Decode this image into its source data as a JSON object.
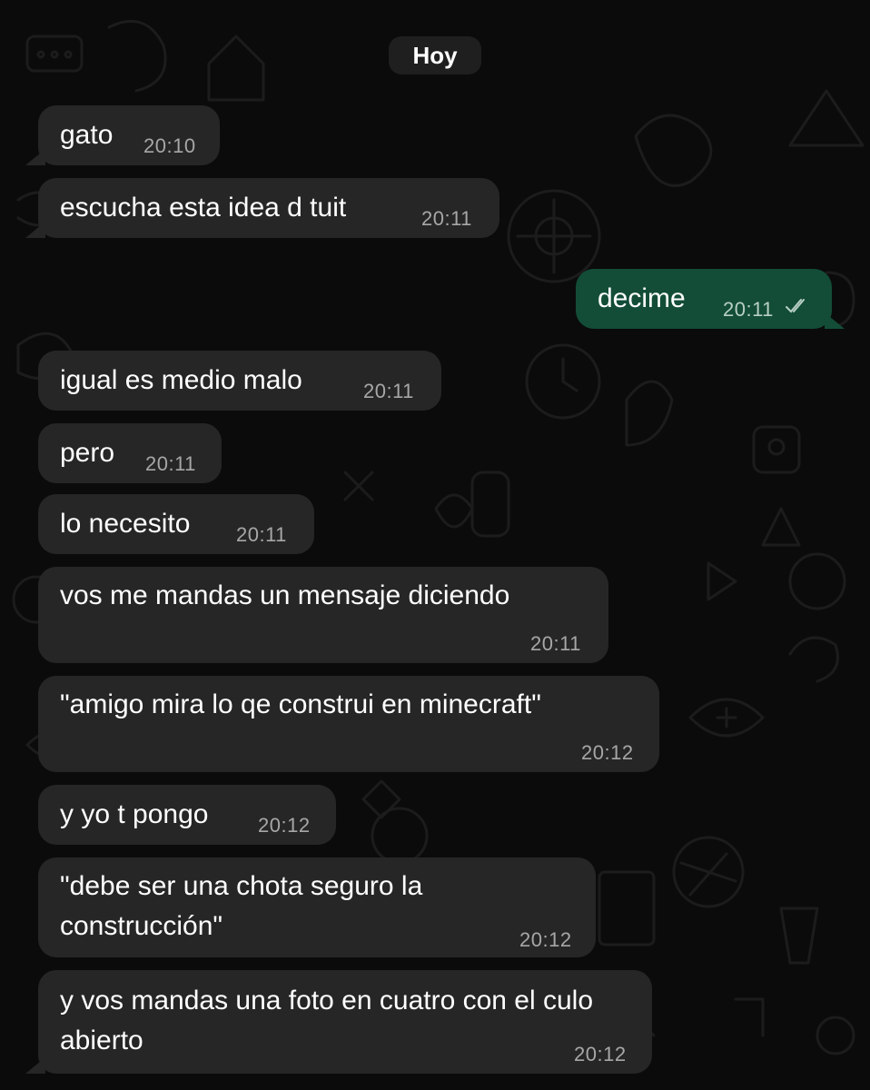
{
  "date_separator": "Hoy",
  "messages": [
    {
      "dir": "in",
      "text": "gato",
      "time": "20:10"
    },
    {
      "dir": "in",
      "text": "escucha esta idea d tuit",
      "time": "20:11"
    },
    {
      "dir": "out",
      "text": "decime",
      "time": "20:11",
      "status": "read-double-check-icon"
    },
    {
      "dir": "in",
      "text": "igual es medio malo",
      "time": "20:11"
    },
    {
      "dir": "in",
      "text": "pero",
      "time": "20:11"
    },
    {
      "dir": "in",
      "text": "lo necesito",
      "time": "20:11"
    },
    {
      "dir": "in",
      "text": "vos me mandas un mensaje diciendo",
      "time": "20:11"
    },
    {
      "dir": "in",
      "text": "\"amigo mira lo qe construi en minecraft\"",
      "time": "20:12"
    },
    {
      "dir": "in",
      "text": "y yo t pongo",
      "time": "20:12"
    },
    {
      "dir": "in",
      "text": "\"debe ser una chota seguro la construcción\"",
      "time": "20:12"
    },
    {
      "dir": "in",
      "text": "y vos mandas una foto en cuatro con el culo abierto",
      "time": "20:12"
    }
  ],
  "colors": {
    "background": "#0b0b0b",
    "incoming_bubble": "#262626",
    "outgoing_bubble": "#134d37",
    "timestamp": "#a7a7a7",
    "text": "#ffffff"
  }
}
